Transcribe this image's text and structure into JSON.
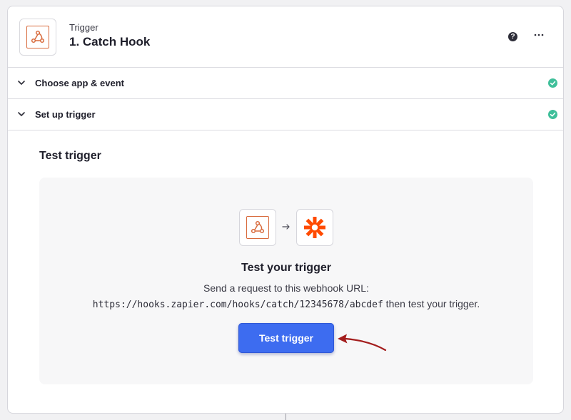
{
  "header": {
    "subtitle": "Trigger",
    "title": "1. Catch Hook",
    "app_icon": "webhook-icon",
    "help_icon": "question-icon",
    "help_glyph": "?",
    "more_icon": "more-horizontal-icon"
  },
  "sections": [
    {
      "label": "Choose app & event",
      "status_icon": "check-circle-icon"
    },
    {
      "label": "Set up trigger",
      "status_icon": "check-circle-icon"
    }
  ],
  "test": {
    "heading": "Test trigger",
    "panel_title": "Test your trigger",
    "desc_line1": "Send a request to this webhook URL:",
    "url": "https://hooks.zapier.com/hooks/catch/12345678/abcdef",
    "desc_suffix": " then test your trigger.",
    "button_label": "Test trigger",
    "source_icon": "webhook-icon",
    "target_icon": "zapier-icon"
  },
  "colors": {
    "accent": "#3d6cf0",
    "check": "#3fbf9a",
    "webhook": "#d86a3c",
    "zapier": "#ff4a00",
    "annotation": "#a31d1d"
  }
}
